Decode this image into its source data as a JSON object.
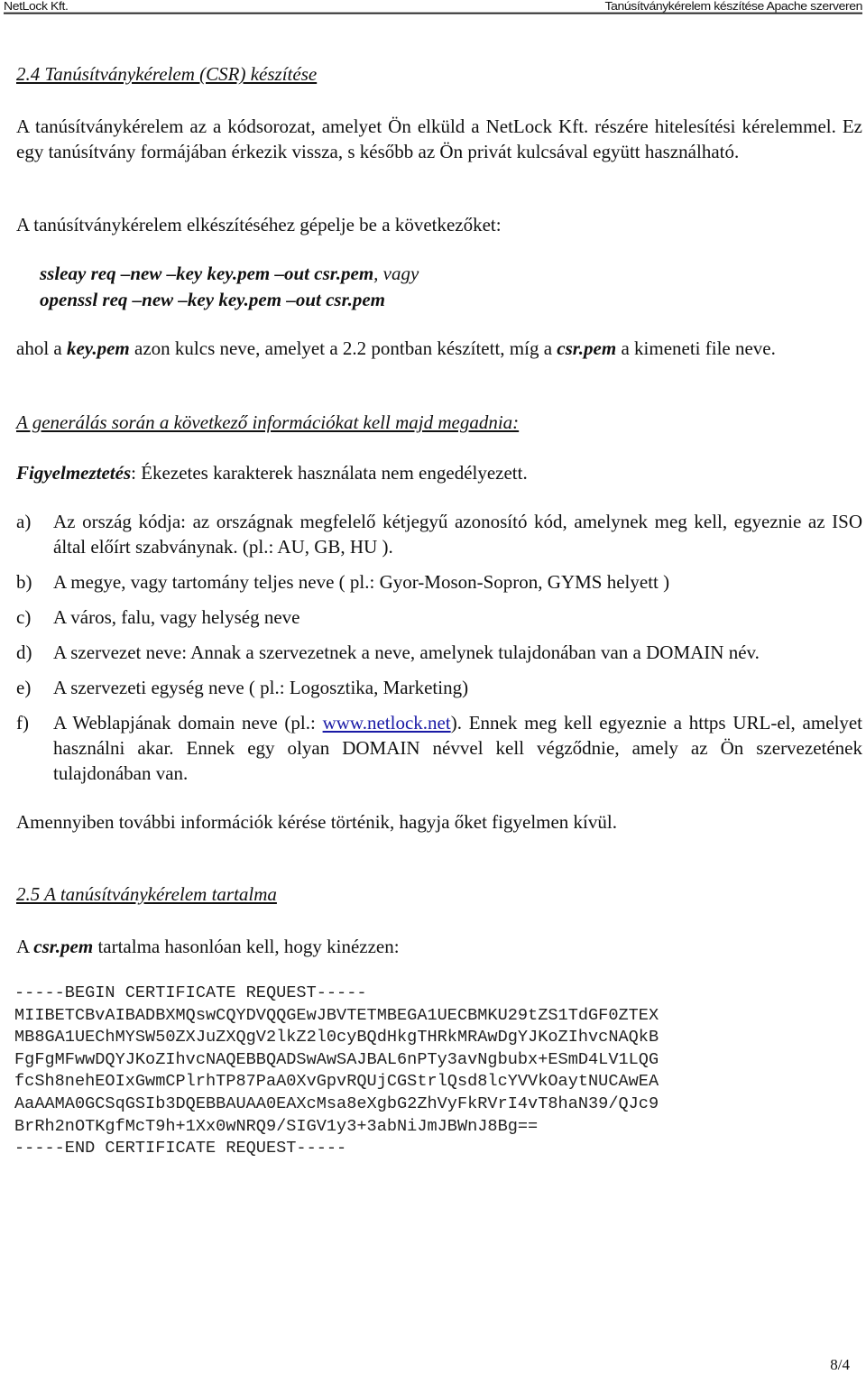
{
  "header": {
    "left": "NetLock Kft.",
    "right": "Tanúsítványkérelem készítése Apache szerveren"
  },
  "section_24": {
    "heading": "2.4 Tanúsítványkérelem (CSR) készítése",
    "intro": "A tanúsítványkérelem az a kódsorozat, amelyet Ön elküld a NetLock Kft. részére hitelesítési kérelemmel. Ez egy tanúsítvány formájában érkezik vissza, s később az Ön privát kulcsával együtt használható.",
    "instruction": "A tanúsítványkérelem elkészítéséhez gépelje be a következőket:",
    "commands": {
      "ssleay": "ssleay req –new –key key.pem –out csr.pem",
      "separator": ", vagy",
      "openssl": "openssl req –new –key key.pem –out csr.pem"
    },
    "explanation": {
      "part1": "ahol a ",
      "key_file": "key.pem",
      "part2": " azon  kulcs neve, amelyet a 2.2 pontban készített, míg a ",
      "csr_file": "csr.pem",
      "part3": " a kimeneti file neve."
    },
    "subheading": "A generálás során a következő információkat kell majd megadnia:",
    "warning": {
      "label": "Figyelmeztetés",
      "text": ": Ékezetes karakterek használata nem engedélyezett."
    },
    "items": [
      {
        "marker": "a)",
        "text": "Az ország kódja: az országnak megfelelő kétjegyű azonosító kód, amelynek meg kell, egyeznie az ISO által előírt szabványnak. (pl.: AU, GB, HU )."
      },
      {
        "marker": "b)",
        "text": "A megye, vagy tartomány teljes neve ( pl.: Gyor-Moson-Sopron, GYMS helyett )"
      },
      {
        "marker": "c)",
        "text": "A város, falu, vagy helység neve"
      },
      {
        "marker": "d)",
        "text": "A szervezet neve: Annak a szervezetnek a neve, amelynek tulajdonában van a DOMAIN név."
      },
      {
        "marker": "e)",
        "text": "A szervezeti egység neve ( pl.: Logosztika, Marketing)"
      },
      {
        "marker": "f)",
        "text_before": "A Weblapjának domain neve (pl.: ",
        "link": "www.netlock.net",
        "text_after": "). Ennek meg kell egyeznie a https URL-el, amelyet használni akar. Ennek egy olyan DOMAIN névvel kell végződnie, amely az Ön szervezetének tulajdonában van."
      }
    ],
    "closing": "Amennyiben további információk kérése történik, hagyja őket figyelmen kívül."
  },
  "section_25": {
    "heading": "2.5 A tanúsítványkérelem tartalma",
    "intro_before": "A ",
    "intro_file": "csr.pem",
    "intro_after": " tartalma hasonlóan kell, hogy kinézzen:",
    "csr_lines": [
      "-----BEGIN CERTIFICATE REQUEST-----",
      "MIIBETCBvAIBADBXMQswCQYDVQQGEwJBVTETMBEGA1UECBMKU29tZS1TdGF0ZTEX",
      "MB8GA1UEChMYSW50ZXJuZXQgV2lkZ2l0cyBQdHkgTHRkMRAwDgYJKoZIhvcNAQkB",
      "FgFgMFwwDQYJKoZIhvcNAQEBBQADSwAwSAJBAL6nPTy3avNgbubx+ESmD4LV1LQG",
      "fcSh8nehEOIxGwmCPlrhTP87PaA0XvGpvRQUjCGStrlQsd8lcYVVkOaytNUCAwEA",
      "AaAAMA0GCSqGSIb3DQEBBAUAA0EAXcMsa8eXgbG2ZhVyFkRVrI4vT8haN39/QJc9",
      "BrRh2nOTKgfMcT9h+1Xx0wNRQ9/SIGV1y3+3abNiJmJBWnJ8Bg==",
      "-----END CERTIFICATE REQUEST-----"
    ]
  },
  "footer": {
    "page_number": "8/4"
  },
  "colors": {
    "text": "#111111",
    "link": "#1a1aa6",
    "background": "#ffffff"
  }
}
